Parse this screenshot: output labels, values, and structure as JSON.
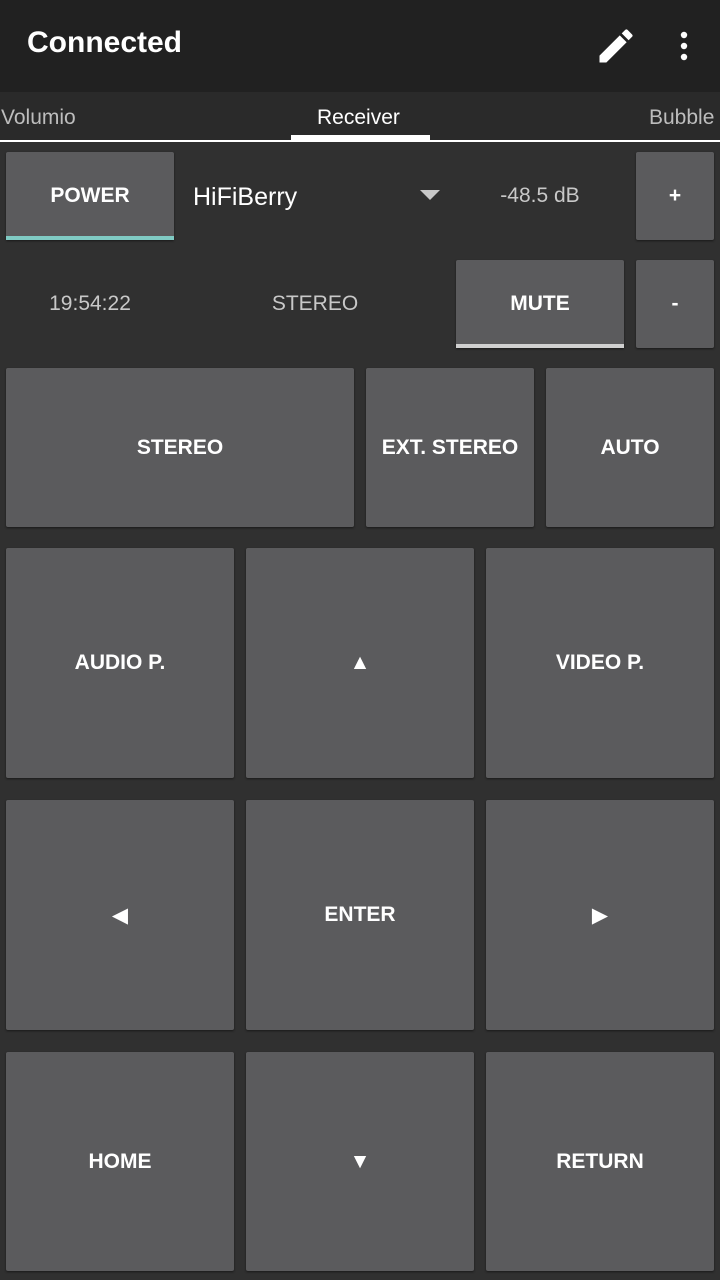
{
  "appbar": {
    "title": "Connected",
    "edit_icon": "pencil-icon",
    "more_icon": "more-vert-icon"
  },
  "tabs": [
    {
      "label": "Volumio",
      "active": false
    },
    {
      "label": "Receiver",
      "active": true
    },
    {
      "label": "Bubble",
      "active": false
    }
  ],
  "controls": {
    "power_label": "POWER",
    "source_selected": "HiFiBerry",
    "volume_level": "-48.5 dB",
    "vol_up_label": "+",
    "time": "19:54:22",
    "listening_mode_status": "STEREO",
    "mute_label": "MUTE",
    "vol_down_label": "-"
  },
  "modes": {
    "stereo": "STEREO",
    "ext_stereo": "EXT. STEREO",
    "auto": "AUTO"
  },
  "pad": {
    "audio_p": "AUDIO P.",
    "up": "▲",
    "video_p": "VIDEO P.",
    "left": "◀",
    "enter": "ENTER",
    "right": "▶",
    "home": "HOME",
    "down": "▼",
    "return": "RETURN"
  },
  "colors": {
    "background": "#303030",
    "appbar": "#212121",
    "button": "#5b5b5d",
    "power_accent": "#80cbc4"
  }
}
